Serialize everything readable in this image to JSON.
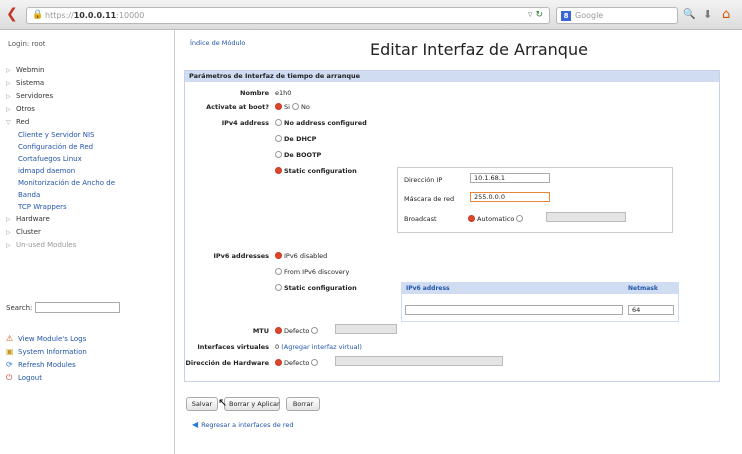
{
  "browser": {
    "url_prefix": "https://",
    "url_host": "10.0.0.11",
    "url_port": ":10000",
    "search_placeholder": "Google"
  },
  "sidebar": {
    "login": "Login: root",
    "items": [
      {
        "label": "Webmin",
        "expanded": false
      },
      {
        "label": "Sistema",
        "expanded": false
      },
      {
        "label": "Servidores",
        "expanded": false
      },
      {
        "label": "Otros",
        "expanded": false
      },
      {
        "label": "Red",
        "expanded": true
      }
    ],
    "red_children": [
      "Cliente y Servidor NIS",
      "Configuración de Red",
      "Cortafuegos Linux",
      "idmapd daemon",
      "Monitorización de Ancho de",
      "Banda",
      "TCP Wrappers"
    ],
    "more_items": [
      {
        "label": "Hardware"
      },
      {
        "label": "Cluster"
      },
      {
        "label": "Un-used Modules"
      }
    ],
    "search_label": "Search:",
    "links": [
      {
        "label": "View Module's Logs",
        "icon": "warning-icon"
      },
      {
        "label": "System Information",
        "icon": "system-icon"
      },
      {
        "label": "Refresh Modules",
        "icon": "refresh-icon"
      },
      {
        "label": "Logout",
        "icon": "logout-icon"
      }
    ]
  },
  "main": {
    "module_index": "Índice de Módulo",
    "title": "Editar Interfaz de Arranque",
    "panel_header": "Parámetros de Interfaz de tiempo de arranque",
    "name_label": "Nombre",
    "name_value": "e1h0",
    "activate_label": "Activate at boot?",
    "yes": "Si",
    "no": "No",
    "ipv4_label": "IPv4 address",
    "ipv4_options": [
      "No address configured",
      "De DHCP",
      "De BOOTP",
      "Static configuration"
    ],
    "ip_label": "Dirección IP",
    "ip_value": "10.1.68.1",
    "mask_label": "Máscara de red",
    "mask_value": "255.0.0.0",
    "broadcast_label": "Broadcast",
    "broadcast_auto": "Automatico",
    "ipv6_label": "IPv6 addresses",
    "ipv6_options": [
      "IPv6 disabled",
      "From IPv6 discovery",
      "Static configuration"
    ],
    "ipv6_col_address": "IPv6 address",
    "ipv6_col_netmask": "Netmask",
    "ipv6_netmask_value": "64",
    "mtu_label": "MTU",
    "default": "Defecto",
    "virtual_label": "Interfaces virtuales",
    "virtual_value": "0",
    "virtual_link": "(Agregar interfaz virtual)",
    "hw_label": "Dirección de Hardware",
    "buttons": {
      "save": "Salvar",
      "delete_apply": "Borrar y Aplicar",
      "delete": "Borrar"
    },
    "return_link": "Regresar a interfaces de red"
  },
  "colors": {
    "accent": "#2255aa",
    "radio_on": "#e0452b",
    "header_bg": "#cfdcf2"
  }
}
